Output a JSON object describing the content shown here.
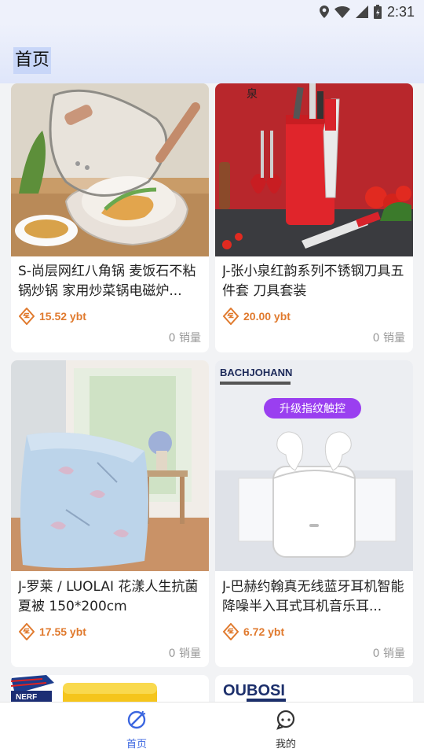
{
  "status_bar": {
    "time": "2:31"
  },
  "header": {
    "title": "首页"
  },
  "products": [
    {
      "title": "S-尚层网红八角锅 麦饭石不粘锅炒锅 家用炒菜锅电磁炉...",
      "price": "15.52 ybt",
      "sales": "0 销量"
    },
    {
      "title": "J-张小泉红韵系列不锈钢刀具五件套 刀具套装",
      "price": "20.00 ybt",
      "sales": "0 销量",
      "image_text": "泉"
    },
    {
      "title": "J-罗莱 / LUOLAI 花漾人生抗菌夏被 150*200cm",
      "price": "17.55 ybt",
      "sales": "0 销量"
    },
    {
      "title": "J-巴赫约翰真无线蓝牙耳机智能降噪半入耳式耳机音乐耳...",
      "price": "6.72 ybt",
      "sales": "0 销量",
      "image_brand": "BACHJOHANN",
      "image_badge": "升级指纹触控"
    },
    {
      "image_brand": "NERF"
    },
    {
      "image_brand": "OUBOSI"
    }
  ],
  "bottom_nav": [
    {
      "label": "首页",
      "icon": "home-icon",
      "active": true
    },
    {
      "label": "我的",
      "icon": "profile-icon",
      "active": false
    }
  ],
  "colors": {
    "accent": "#3b66e0",
    "price": "#e07a2e",
    "background": "#f2f3f5"
  }
}
